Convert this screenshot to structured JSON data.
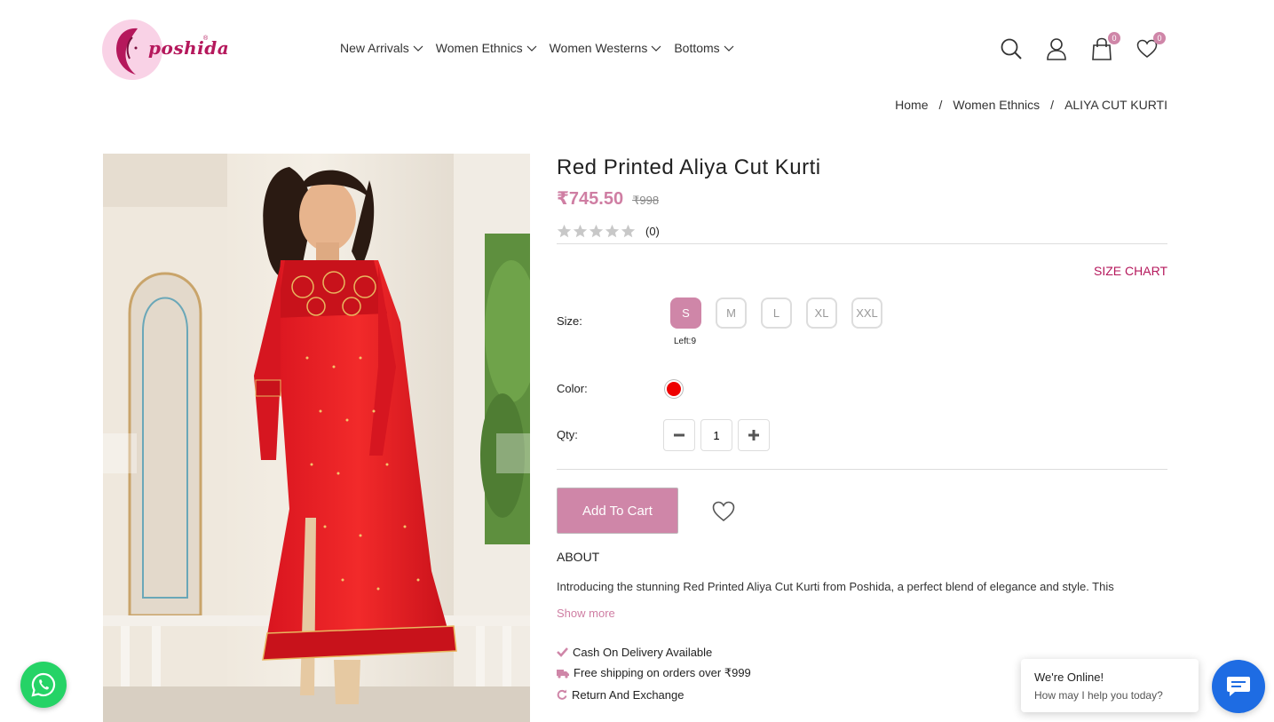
{
  "brand": {
    "logo_text": "poshida",
    "logo_mark": "®"
  },
  "nav": [
    {
      "label": "New Arrivals"
    },
    {
      "label": "Women Ethnics"
    },
    {
      "label": "Women Westerns"
    },
    {
      "label": "Bottoms"
    }
  ],
  "header_icons": {
    "search": "search-icon",
    "account": "user-icon",
    "cart": {
      "icon": "shopping-bag-icon",
      "count": "0"
    },
    "wishlist": {
      "icon": "heart-icon",
      "count": "0"
    }
  },
  "breadcrumb": {
    "home": "Home",
    "sep": "/",
    "category": "Women Ethnics",
    "current": "ALIYA CUT KURTI"
  },
  "product": {
    "title": "Red Printed Aliya Cut Kurti",
    "price": "₹745.50",
    "mrp": "₹998",
    "rating_count": "(0)",
    "stars": 0,
    "size_chart": "SIZE CHART",
    "size_label": "Size:",
    "sizes": [
      "S",
      "M",
      "L",
      "XL",
      "XXL"
    ],
    "selected_size": "S",
    "stock_left": "Left:9",
    "color_label": "Color:",
    "color": "#ee0000",
    "qty_label": "Qty:",
    "qty": "1",
    "add_to_cart": "Add To Cart",
    "about_title": "ABOUT",
    "description": "Introducing the stunning Red Printed Aliya Cut Kurti from Poshida, a perfect blend of elegance and style. This",
    "show_more": "Show more",
    "features": [
      "Cash On Delivery Available",
      "Free shipping on orders over ₹999",
      "Return And Exchange"
    ]
  },
  "chat": {
    "title": "We're Online!",
    "subtitle": "How may I help you today?"
  },
  "colors": {
    "accent": "#cf86a8",
    "brand": "#b5185c",
    "whatsapp": "#25d366",
    "chat": "#1e6ce3"
  }
}
